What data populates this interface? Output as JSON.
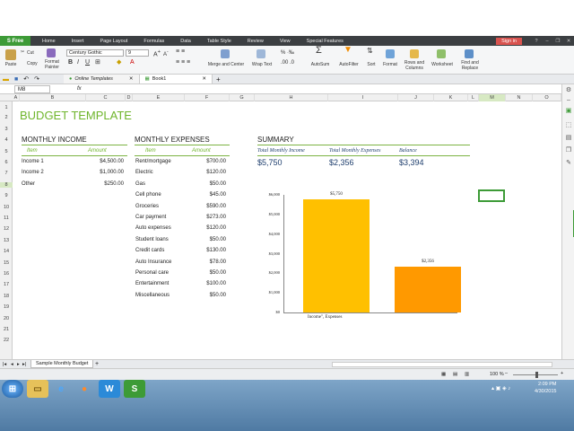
{
  "top_gap": {},
  "menubar": {
    "app": "S Free",
    "items": [
      "Home",
      "Insert",
      "Page Layout",
      "Formulas",
      "Data",
      "Table Style",
      "Review",
      "View",
      "Special Features"
    ],
    "signin": "Sign in"
  },
  "ribbon": {
    "paste": "Paste",
    "cut": "Cut",
    "copy": "Copy",
    "format_painter": "Format Painter",
    "font_name": "Century Gothic",
    "font_size": "9",
    "merge_center": "Merge and Center",
    "wrap_text": "Wrap Text",
    "autosum": "AutoSum",
    "autofilter": "AutoFilter",
    "sort": "Sort",
    "format": "Format",
    "rows_columns": "Rows and Columns",
    "worksheet": "Worksheet",
    "find_replace": "Find and Replace"
  },
  "tabs": {
    "online": "Online Templates",
    "book": "Book1"
  },
  "formula": {
    "cell": "M8",
    "fx": "fx"
  },
  "columns": [
    "A",
    "B",
    "C",
    "D",
    "E",
    "F",
    "G",
    "H",
    "I",
    "J",
    "K",
    "L",
    "M",
    "N",
    "O"
  ],
  "rows": [
    "1",
    "2",
    "3",
    "4",
    "5",
    "6",
    "7",
    "8",
    "9",
    "10",
    "11",
    "12",
    "13",
    "14",
    "15",
    "16",
    "17",
    "18",
    "19",
    "20",
    "21",
    "22"
  ],
  "sheet": {
    "title": "BUDGET TEMPLATE",
    "income": {
      "heading": "MONTHLY INCOME",
      "col_item": "Item",
      "col_amount": "Amount",
      "rows": [
        {
          "item": "Income 1",
          "amount": "$4,500.00"
        },
        {
          "item": "Income 2",
          "amount": "$1,000.00"
        },
        {
          "item": "Other",
          "amount": "$250.00"
        }
      ]
    },
    "expenses": {
      "heading": "MONTHLY EXPENSES",
      "col_item": "Item",
      "col_amount": "Amount",
      "rows": [
        {
          "item": "Rent/mortgage",
          "amount": "$700.00"
        },
        {
          "item": "Electric",
          "amount": "$120.00"
        },
        {
          "item": "Gas",
          "amount": "$50.00"
        },
        {
          "item": "Cell phone",
          "amount": "$45.00"
        },
        {
          "item": "Groceries",
          "amount": "$590.00"
        },
        {
          "item": "Car payment",
          "amount": "$273.00"
        },
        {
          "item": "Auto expenses",
          "amount": "$120.00"
        },
        {
          "item": "Student loans",
          "amount": "$50.00"
        },
        {
          "item": "Credit cards",
          "amount": "$130.00"
        },
        {
          "item": "Auto Insurance",
          "amount": "$78.00"
        },
        {
          "item": "Personal care",
          "amount": "$50.00"
        },
        {
          "item": "Entertainment",
          "amount": "$100.00"
        },
        {
          "item": "Miscellaneous",
          "amount": "$50.00"
        }
      ]
    },
    "summary": {
      "heading": "SUMMARY",
      "col_income": "Total Monthly Income",
      "col_expenses": "Total Monthly Expenses",
      "col_balance": "Balance",
      "income": "$5,750",
      "expenses": "$2,356",
      "balance": "$3,394"
    }
  },
  "chart_data": {
    "type": "bar",
    "categories": [
      "Income",
      "Expenses"
    ],
    "values": [
      5750,
      2356
    ],
    "data_labels": [
      "$5,750",
      "$2,356"
    ],
    "x_label_text": "Income\", Expenses",
    "yticks": [
      "$0",
      "$1,000",
      "$2,000",
      "$3,000",
      "$4,000",
      "$5,000",
      "$6,000"
    ],
    "ylim": [
      0,
      6000
    ],
    "colors": [
      "#ffc000",
      "#ff9900"
    ]
  },
  "sheettabs": {
    "active": "Sample Monthly Budget",
    "add": "+"
  },
  "status": {
    "zoom": "100 %"
  },
  "taskbar": {
    "time": "2:09 PM",
    "date": "4/30/2015"
  },
  "colors": {
    "accent": "#7cb342",
    "title_green": "#6fb52c",
    "summary_blue": "#1f3f6e",
    "app_green": "#3d9b37"
  }
}
